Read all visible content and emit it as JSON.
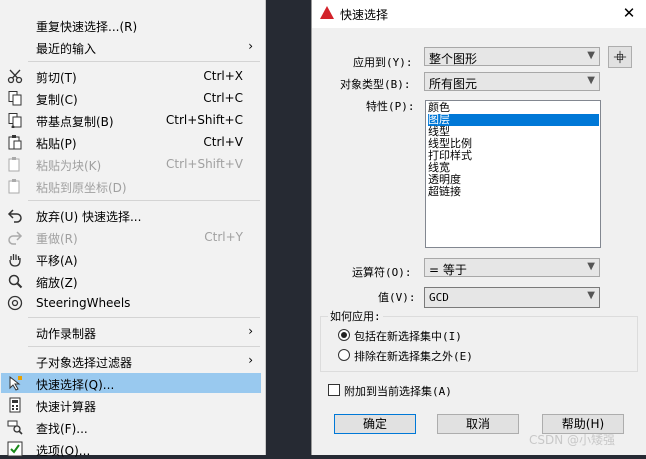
{
  "menu": {
    "repeat": "重复快速选择...(R)",
    "recent": "最近的输入",
    "cut": "剪切(T)",
    "cut_sc": "Ctrl+X",
    "copy": "复制(C)",
    "copy_sc": "Ctrl+C",
    "copybase": "带基点复制(B)",
    "copybase_sc": "Ctrl+Shift+C",
    "paste": "粘贴(P)",
    "paste_sc": "Ctrl+V",
    "pasteblock": "粘贴为块(K)",
    "pasteblock_sc": "Ctrl+Shift+V",
    "pasteorig": "粘贴到原坐标(D)",
    "undo": "放弃(U) 快速选择...",
    "redo": "重做(R)",
    "redo_sc": "Ctrl+Y",
    "pan": "平移(A)",
    "zoom": "缩放(Z)",
    "steering": "SteeringWheels",
    "actionrec": "动作录制器",
    "subfilter": "子对象选择过滤器",
    "quicksel": "快速选择(Q)...",
    "quickcalc": "快速计算器",
    "find": "查找(F)...",
    "options": "选项(O)..."
  },
  "dialog": {
    "title": "快速选择",
    "close": "✕",
    "apply_to_label": "应用到(Y):",
    "apply_to_value": "整个图形",
    "obj_type_label": "对象类型(B):",
    "obj_type_value": "所有图元",
    "props_label": "特性(P):",
    "properties": [
      "颜色",
      "图层",
      "线型",
      "线型比例",
      "打印样式",
      "线宽",
      "透明度",
      "超链接"
    ],
    "operator_label": "运算符(O):",
    "operator_value": "= 等于",
    "value_label": "值(V):",
    "value_value": "GCD",
    "how_apply_label": "如何应用:",
    "include_label": "包括在新选择集中(I)",
    "exclude_label": "排除在新选择集之外(E)",
    "append_label": "附加到当前选择集(A)",
    "ok": "确定",
    "cancel": "取消",
    "help": "帮助(H)"
  },
  "watermark": "CSDN @小矮强"
}
